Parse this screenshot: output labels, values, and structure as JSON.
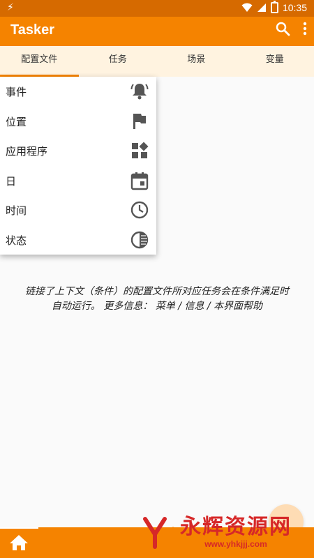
{
  "status_bar": {
    "time": "10:35",
    "icons": [
      "bolt-icon",
      "wifi-icon",
      "signal-icon",
      "battery-icon"
    ]
  },
  "app_bar": {
    "title": "Tasker",
    "actions": [
      "search-icon",
      "more-vert-icon"
    ],
    "color": "#f58300"
  },
  "tabs": [
    {
      "label": "配置文件",
      "active": true
    },
    {
      "label": "任务",
      "active": false
    },
    {
      "label": "场景",
      "active": false
    },
    {
      "label": "变量",
      "active": false
    }
  ],
  "context_menu": {
    "items": [
      {
        "label": "事件",
        "icon": "bell-icon"
      },
      {
        "label": "位置",
        "icon": "flag-icon"
      },
      {
        "label": "应用程序",
        "icon": "apps-icon"
      },
      {
        "label": "日",
        "icon": "calendar-icon"
      },
      {
        "label": "时间",
        "icon": "clock-icon"
      },
      {
        "label": "状态",
        "icon": "state-icon"
      }
    ]
  },
  "info_text": {
    "line1": "链接了上下文（条件）的配置文件所对应任务会在条件满足时",
    "line2": "自动运行。 更多信息： 菜单 / 信息 / 本界面帮助"
  },
  "bottom_bar": {
    "icon": "home-icon"
  },
  "watermark": {
    "text": "永辉资源网",
    "url": "www.yhkjjj.com"
  }
}
